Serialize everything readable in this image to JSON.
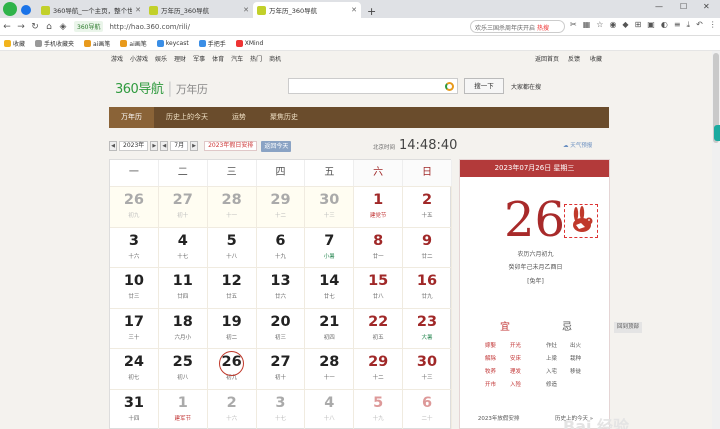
{
  "browser": {
    "tabs": [
      {
        "title": "360导航_一个主页，整个世界",
        "active": false
      },
      {
        "title": "万年历_360导航",
        "active": false
      },
      {
        "title": "万年历_360导航",
        "active": true
      }
    ],
    "new_tab": "+",
    "url": "http://hao.360.com/rili/",
    "url_tag": "360导航",
    "search_text": "欢乐三国杀周年庆开启",
    "search_hot": "热搜",
    "bookmarks": [
      "收藏",
      "手机收藏夹",
      "ai画笔",
      "ai画笔",
      "keycast",
      "手把手",
      "XMind"
    ],
    "window": {
      "minimize": "—",
      "maximize": "☐",
      "close": "✕"
    }
  },
  "site": {
    "nav_left": [
      "游戏",
      "小游戏",
      "娱乐",
      "理财",
      "军事",
      "体育",
      "汽车",
      "热门",
      "商机"
    ],
    "nav_right": [
      "返回首页",
      "反馈",
      "收藏"
    ],
    "logo_brand": "360导航",
    "logo_page": "万年历",
    "search_button": "搜一下",
    "search_link": "大家都在搜",
    "tabs": [
      "万年历",
      "历史上的今天",
      "运势",
      "聚焦历史"
    ]
  },
  "controls": {
    "year": "2023年",
    "month": "7月",
    "holiday": "2023年假日安排",
    "today_button": "返回今天",
    "clock_label": "北京时间",
    "clock": "14:48:40",
    "weather": "天气预报"
  },
  "calendar": {
    "weekdays": [
      "一",
      "二",
      "三",
      "四",
      "五",
      "六",
      "日"
    ],
    "weeks": [
      [
        {
          "d": "26",
          "l": "初九",
          "o": 1
        },
        {
          "d": "27",
          "l": "初十",
          "o": 1
        },
        {
          "d": "28",
          "l": "十一",
          "o": 1
        },
        {
          "d": "29",
          "l": "十二",
          "o": 1
        },
        {
          "d": "30",
          "l": "十三",
          "o": 1
        },
        {
          "d": "1",
          "l": "建党节",
          "h": 1
        },
        {
          "d": "2",
          "l": "十五"
        }
      ],
      [
        {
          "d": "3",
          "l": "十六"
        },
        {
          "d": "4",
          "l": "十七"
        },
        {
          "d": "5",
          "l": "十八"
        },
        {
          "d": "6",
          "l": "十九"
        },
        {
          "d": "7",
          "l": "小暑",
          "j": 1
        },
        {
          "d": "8",
          "l": "廿一"
        },
        {
          "d": "9",
          "l": "廿二"
        }
      ],
      [
        {
          "d": "10",
          "l": "廿三"
        },
        {
          "d": "11",
          "l": "廿四"
        },
        {
          "d": "12",
          "l": "廿五"
        },
        {
          "d": "13",
          "l": "廿六"
        },
        {
          "d": "14",
          "l": "廿七"
        },
        {
          "d": "15",
          "l": "廿八"
        },
        {
          "d": "16",
          "l": "廿九"
        }
      ],
      [
        {
          "d": "17",
          "l": "三十"
        },
        {
          "d": "18",
          "l": "六月小"
        },
        {
          "d": "19",
          "l": "初二"
        },
        {
          "d": "20",
          "l": "初三"
        },
        {
          "d": "21",
          "l": "初四"
        },
        {
          "d": "22",
          "l": "初五"
        },
        {
          "d": "23",
          "l": "大暑",
          "j": 1
        }
      ],
      [
        {
          "d": "24",
          "l": "初七"
        },
        {
          "d": "25",
          "l": "初八"
        },
        {
          "d": "26",
          "l": "初九",
          "c": 1
        },
        {
          "d": "27",
          "l": "初十"
        },
        {
          "d": "28",
          "l": "十一"
        },
        {
          "d": "29",
          "l": "十二"
        },
        {
          "d": "30",
          "l": "十三"
        }
      ],
      [
        {
          "d": "31",
          "l": "十四"
        },
        {
          "d": "1",
          "l": "建军节",
          "o": 1,
          "h": 1
        },
        {
          "d": "2",
          "l": "十六",
          "o": 1
        },
        {
          "d": "3",
          "l": "十七",
          "o": 1
        },
        {
          "d": "4",
          "l": "十八",
          "o": 1
        },
        {
          "d": "5",
          "l": "十九",
          "o": 1
        },
        {
          "d": "6",
          "l": "二十",
          "o": 1
        }
      ]
    ]
  },
  "detail": {
    "header": "2023年07月26日 星期三",
    "day": "26",
    "lunar": "农历六月初九",
    "ganzhi": "癸卯年己未月乙酉日",
    "zodiac": "[兔年]",
    "yi_label": "宜",
    "ji_label": "忌",
    "yi": [
      "嫁娶",
      "开光",
      "解除",
      "安床",
      "牧养",
      "理发",
      "开市",
      "入殓"
    ],
    "ji": [
      "作灶",
      "出火",
      "上梁",
      "栽种",
      "入宅",
      "移徙",
      "修造"
    ],
    "footer": [
      "2023年放假安排",
      "历史上的今天 »"
    ]
  },
  "return_top": "回到顶部",
  "watermark": "Bai 经验"
}
